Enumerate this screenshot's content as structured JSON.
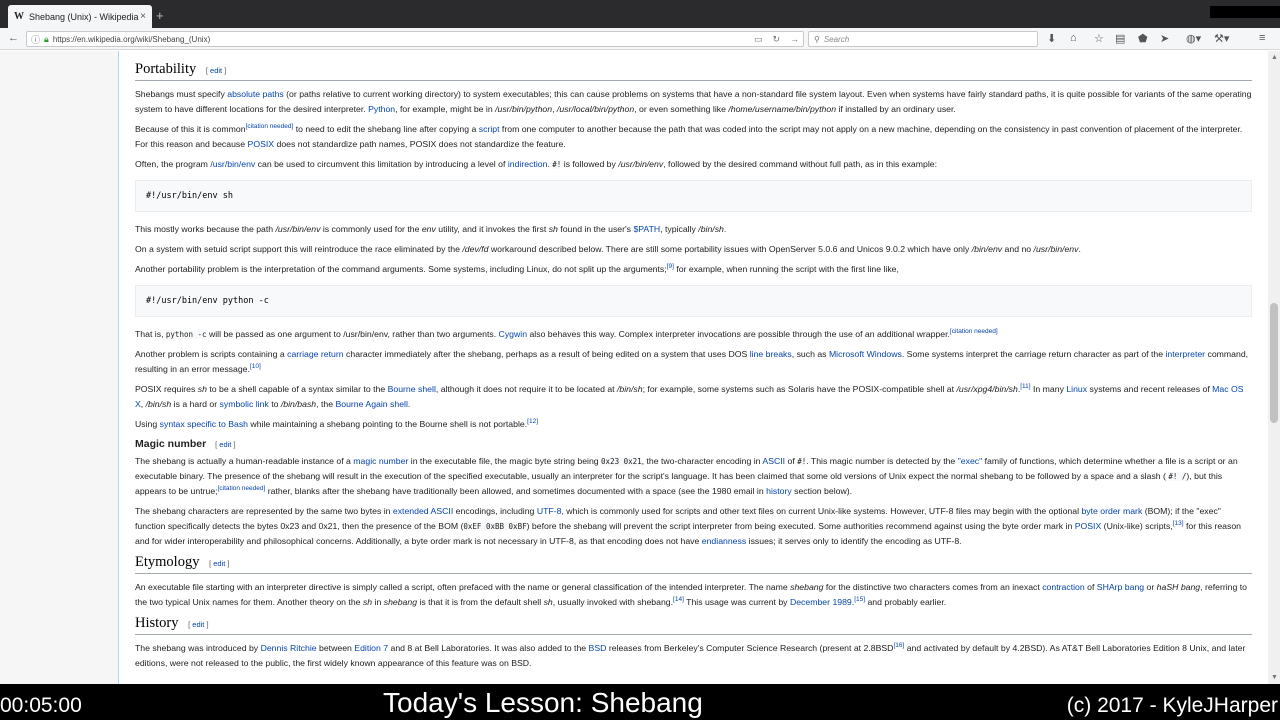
{
  "browser": {
    "tab_title": "Shebang (Unix) - Wikipedia",
    "tab_favicon": "W",
    "tab_close": "×",
    "new_tab": "+",
    "url": "https://en.wikipedia.org/wiki/Shebang_(Unix)",
    "search_placeholder": "Search"
  },
  "sections": {
    "portability": {
      "heading": "Portability",
      "edit": "edit",
      "p1": {
        "a": "Shebangs must specify ",
        "link1": "absolute paths",
        "b": " (or paths relative to current working directory) to system executables; this can cause problems on systems that have a non-standard file system layout. Even when systems have fairly standard paths, it is quite possible for variants of the same operating system to have different locations for the desired interpreter. ",
        "link2": "Python",
        "c": ", for example, might be in ",
        "i1": "/usr/bin/python",
        "d": ", ",
        "i2": "/usr/local/bin/python",
        "e": ", or even something like ",
        "i3": "/home/username/bin/python",
        "f": " if installed by an ordinary user."
      },
      "p2": {
        "a": "Because of this it is common",
        "sup1": "[citation needed]",
        "b": " to need to edit the shebang line after copying a ",
        "link1": "script",
        "c": " from one computer to another because the path that was coded into the script may not apply on a new machine, depending on the consistency in past convention of placement of the interpreter. For this reason and because ",
        "link2": "POSIX",
        "d": " does not standardize path names, POSIX does not standardize the feature."
      },
      "p3": {
        "a": "Often, the program ",
        "link1": "/usr/bin/env",
        "b": " can be used to circumvent this limitation by introducing a level of ",
        "link2": "indirection",
        "c": ". ",
        "code1": "#!",
        "d": " is followed by ",
        "i1": "/usr/bin/env",
        "e": ", followed by the desired command without full path, as in this example:"
      },
      "code1": "#!/usr/bin/env sh",
      "p4": {
        "a": "This mostly works because the path ",
        "i1": "/usr/bin/env",
        "b": " is commonly used for the ",
        "i2": "env",
        "c": " utility, and it invokes the first ",
        "i3": "sh",
        "d": " found in the user's ",
        "link1": "$PATH",
        "e": ", typically ",
        "i4": "/bin/sh",
        "f": "."
      },
      "p5": {
        "a": "On a system with setuid script support this will reintroduce the race eliminated by the ",
        "i1": "/dev/fd",
        "b": " workaround described below. There are still some portability issues with OpenServer 5.0.6 and Unicos 9.0.2 which have only ",
        "i2": "/bin/env",
        "c": " and no ",
        "i3": "/usr/bin/env",
        "d": "."
      },
      "p6": {
        "a": "Another portability problem is the interpretation of the command arguments. Some systems, including Linux, do not split up the arguments;",
        "sup1": "[9]",
        "b": " for example, when running the script with the first line like,"
      },
      "code2": "#!/usr/bin/env python -c",
      "p7": {
        "a": "That is, ",
        "code1": "python -c",
        "b": " will be passed as one argument to /usr/bin/env, rather than two arguments. ",
        "link1": "Cygwin",
        "c": " also behaves this way. Complex interpreter invocations are possible through the use of an additional wrapper.",
        "sup1": "[citation needed]"
      },
      "p8": {
        "a": "Another problem is scripts containing a ",
        "link1": "carriage return",
        "b": " character immediately after the shebang, perhaps as a result of being edited on a system that uses DOS ",
        "link2": "line breaks",
        "c": ", such as ",
        "link3": "Microsoft Windows",
        "d": ". Some systems interpret the carriage return character as part of the ",
        "link4": "interpreter",
        "e": " command, resulting in an error message.",
        "sup1": "[10]"
      },
      "p9": {
        "a": "POSIX requires ",
        "i1": "sh",
        "b": " to be a shell capable of a syntax similar to the ",
        "link1": "Bourne shell",
        "c": ", although it does not require it to be located at ",
        "i2": "/bin/sh",
        "d": "; for example, some systems such as Solaris have the POSIX-compatible shell at ",
        "i3": "/usr/xpg4/bin/sh",
        "e": ".",
        "sup1": "[11]",
        "f": " In many ",
        "link2": "Linux",
        "g": " systems and recent releases of ",
        "link3": "Mac OS X",
        "h": ", ",
        "i4": "/bin/sh",
        "j": " is a hard or ",
        "link4": "symbolic link",
        "k": " to ",
        "i5": "/bin/bash",
        "l": ", the ",
        "link5": "Bourne Again shell",
        "m": "."
      },
      "p10": {
        "a": "Using ",
        "link1": "syntax specific to Bash",
        "b": " while maintaining a shebang pointing to the Bourne shell is not portable.",
        "sup1": "[12]"
      }
    },
    "magic": {
      "heading": "Magic number",
      "edit": "edit",
      "p1": {
        "a": "The shebang is actually a human-readable instance of a ",
        "link1": "magic number",
        "b": " in the executable file, the magic byte string being ",
        "code1": "0x23 0x21",
        "c": ", the two-character encoding in ",
        "link2": "ASCII",
        "d": " of ",
        "code2": "#!",
        "e": ". This magic number is detected by the ",
        "link3": "\"exec\"",
        "f": " family of functions, which determine whether a file is a script or an executable binary. The presence of the shebang will result in the execution of the specified executable, usually an interpreter for the script's language. It has been claimed that some old versions of Unix expect the normal shebang to be followed by a space and a slash ( ",
        "code3": "#! /",
        "g": "), but this appears to be untrue;",
        "sup1": "[citation needed]",
        "h": " rather, blanks after the shebang have traditionally been allowed, and sometimes documented with a space (see the 1980 email in ",
        "link4": "history",
        "i": " section below)."
      },
      "p2": {
        "a": "The shebang characters are represented by the same two bytes in ",
        "link1": "extended ASCII",
        "b": " encodings, including ",
        "link2": "UTF-8",
        "c": ", which is commonly used for scripts and other text files on current Unix-like systems. However, UTF-8 files may begin with the optional ",
        "link3": "byte order mark",
        "d": " (BOM); if the \"exec\" function specifically detects the bytes 0x23 and 0x21, then the presence of the BOM (",
        "code1": "0xEF 0xBB 0xBF",
        "e": ") before the shebang will prevent the script interpreter from being executed. Some authorities recommend against using the byte order mark in ",
        "link4": "POSIX",
        "f": " (Unix-like) scripts,",
        "sup1": "[13]",
        "g": " for this reason and for wider interoperability and philosophical concerns. Additionally, a byte order mark is not necessary in UTF-8, as that encoding does not have ",
        "link5": "endianness",
        "h": " issues; it serves only to identify the encoding as UTF-8."
      }
    },
    "etymology": {
      "heading": "Etymology",
      "edit": "edit",
      "p1": {
        "a": "An executable file starting with an interpreter directive is simply called a script, often prefaced with the name or general classification of the intended interpreter. The name ",
        "i1": "shebang",
        "b": " for the distinctive two characters comes from an inexact ",
        "link1": "contraction",
        "c": " of ",
        "link2": "SHArp bang",
        "d": " or ",
        "i2": "haSH bang",
        "e": ", referring to the two typical Unix names for them. Another theory on the ",
        "i3": "sh",
        "f": " in ",
        "i4": "shebang",
        "g": " is that it is from the default shell ",
        "i5": "sh",
        "h": ", usually invoked with shebang.",
        "sup1": "[14]",
        "j": " This usage was current by ",
        "link3": "December 1989",
        "k": ".",
        "sup2": "[15]",
        "l": " and probably earlier."
      }
    },
    "history": {
      "heading": "History",
      "edit": "edit",
      "p1": {
        "a": "The shebang was introduced by ",
        "link1": "Dennis Ritchie",
        "b": " between ",
        "link2": "Edition 7",
        "c": " and 8 at Bell Laboratories. It was also added to the ",
        "link3": "BSD",
        "d": " releases from Berkeley's Computer Science Research (present at 2.8BSD",
        "sup1": "[16]",
        "e": " and activated by default by 4.2BSD). As AT&T Bell Laboratories Edition 8 Unix, and later editions, were not released to the public, the first widely known appearance of this feature was on BSD."
      }
    }
  },
  "overlay": {
    "timer": "00:05:00",
    "lesson": "Today's Lesson: Shebang",
    "copyright": "(c) 2017 - KyleJHarper"
  }
}
